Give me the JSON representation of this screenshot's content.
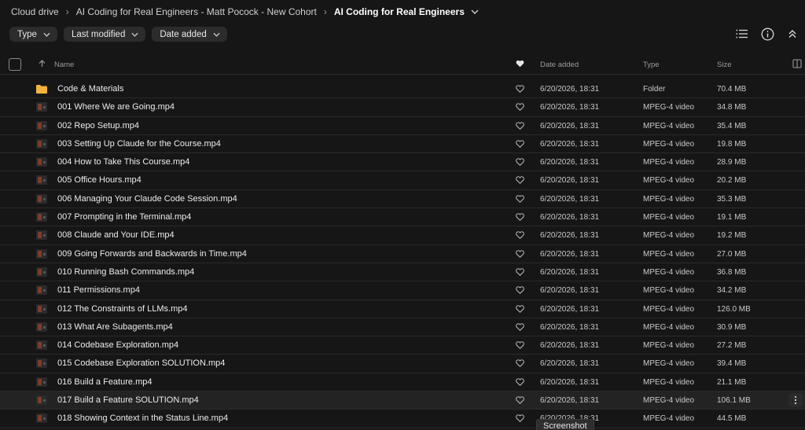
{
  "breadcrumb": {
    "items": [
      "Cloud drive",
      "AI Coding for Real Engineers - Matt Pocock - New Cohort"
    ],
    "current": "AI Coding for Real Engineers"
  },
  "filters": [
    "Type",
    "Last modified",
    "Date added"
  ],
  "table": {
    "headers": {
      "name": "Name",
      "date": "Date added",
      "type": "Type",
      "size": "Size"
    },
    "rows": [
      {
        "name": "Code & Materials",
        "date": "6/20/2026, 18:31",
        "type": "Folder",
        "size": "70.4 MB",
        "kind": "folder"
      },
      {
        "name": "001 Where We are Going.mp4",
        "date": "6/20/2026, 18:31",
        "type": "MPEG-4 video",
        "size": "34.8 MB",
        "kind": "video"
      },
      {
        "name": "002 Repo Setup.mp4",
        "date": "6/20/2026, 18:31",
        "type": "MPEG-4 video",
        "size": "35.4 MB",
        "kind": "video"
      },
      {
        "name": "003 Setting Up Claude for the Course.mp4",
        "date": "6/20/2026, 18:31",
        "type": "MPEG-4 video",
        "size": "19.8 MB",
        "kind": "video"
      },
      {
        "name": "004 How to Take This Course.mp4",
        "date": "6/20/2026, 18:31",
        "type": "MPEG-4 video",
        "size": "28.9 MB",
        "kind": "video"
      },
      {
        "name": "005 Office Hours.mp4",
        "date": "6/20/2026, 18:31",
        "type": "MPEG-4 video",
        "size": "20.2 MB",
        "kind": "video"
      },
      {
        "name": "006 Managing Your Claude Code Session.mp4",
        "date": "6/20/2026, 18:31",
        "type": "MPEG-4 video",
        "size": "35.3 MB",
        "kind": "video"
      },
      {
        "name": "007 Prompting in the Terminal.mp4",
        "date": "6/20/2026, 18:31",
        "type": "MPEG-4 video",
        "size": "19.1 MB",
        "kind": "video"
      },
      {
        "name": "008 Claude and Your IDE.mp4",
        "date": "6/20/2026, 18:31",
        "type": "MPEG-4 video",
        "size": "19.2 MB",
        "kind": "video"
      },
      {
        "name": "009 Going Forwards and Backwards in Time.mp4",
        "date": "6/20/2026, 18:31",
        "type": "MPEG-4 video",
        "size": "27.0 MB",
        "kind": "video"
      },
      {
        "name": "010 Running Bash Commands.mp4",
        "date": "6/20/2026, 18:31",
        "type": "MPEG-4 video",
        "size": "36.8 MB",
        "kind": "video"
      },
      {
        "name": "011 Permissions.mp4",
        "date": "6/20/2026, 18:31",
        "type": "MPEG-4 video",
        "size": "34.2 MB",
        "kind": "video"
      },
      {
        "name": "012 The Constraints of LLMs.mp4",
        "date": "6/20/2026, 18:31",
        "type": "MPEG-4 video",
        "size": "126.0 MB",
        "kind": "video"
      },
      {
        "name": "013 What Are Subagents.mp4",
        "date": "6/20/2026, 18:31",
        "type": "MPEG-4 video",
        "size": "30.9 MB",
        "kind": "video"
      },
      {
        "name": "014 Codebase Exploration.mp4",
        "date": "6/20/2026, 18:31",
        "type": "MPEG-4 video",
        "size": "27.2 MB",
        "kind": "video"
      },
      {
        "name": "015 Codebase Exploration SOLUTION.mp4",
        "date": "6/20/2026, 18:31",
        "type": "MPEG-4 video",
        "size": "39.4 MB",
        "kind": "video"
      },
      {
        "name": "016 Build a Feature.mp4",
        "date": "6/20/2026, 18:31",
        "type": "MPEG-4 video",
        "size": "21.1 MB",
        "kind": "video"
      },
      {
        "name": "017 Build a Feature SOLUTION.mp4",
        "date": "6/20/2026, 18:31",
        "type": "MPEG-4 video",
        "size": "106.1 MB",
        "kind": "video",
        "hover": true
      },
      {
        "name": "018 Showing Context in the Status Line.mp4",
        "date": "6/20/2026, 18:31",
        "type": "MPEG-4 video",
        "size": "44.5 MB",
        "kind": "video"
      }
    ]
  },
  "tooltip": "Screenshot",
  "colors": {
    "background": "#161616",
    "folder": "#f2b33d",
    "row_hover": "#232323"
  }
}
